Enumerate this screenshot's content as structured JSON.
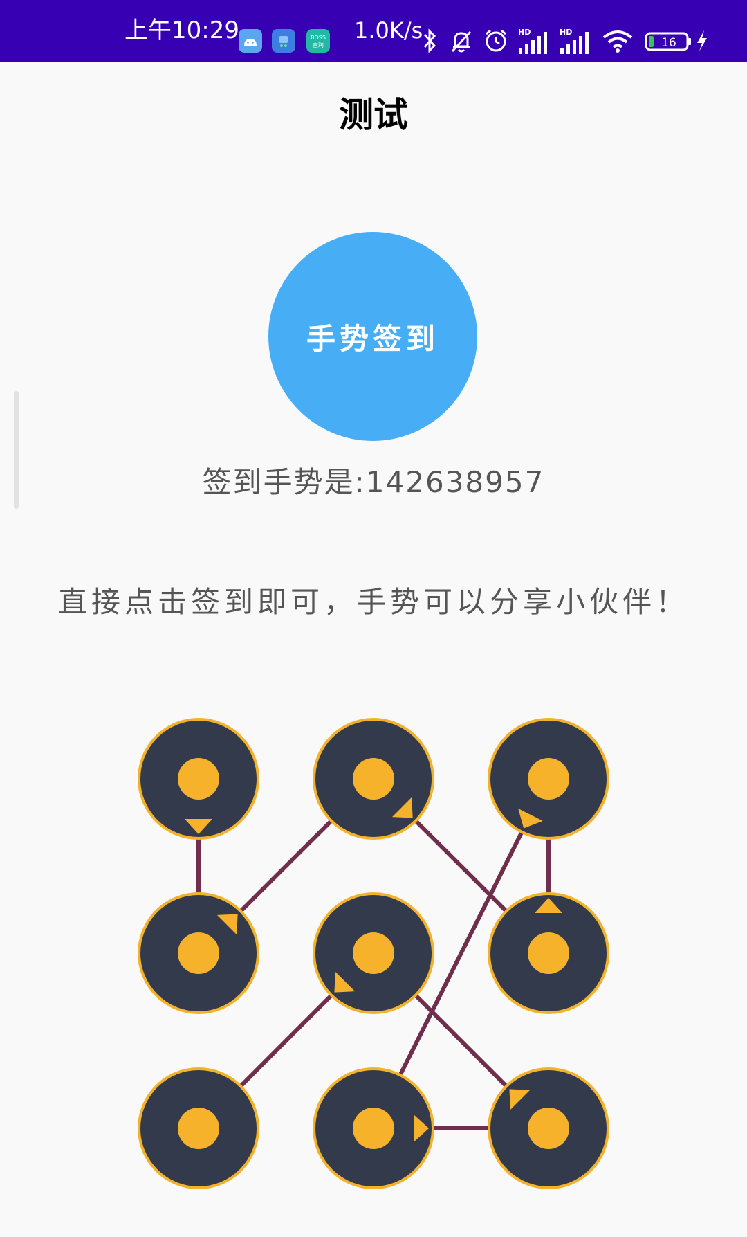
{
  "status_bar": {
    "time": "上午10:29",
    "network_speed": "1.0K/s",
    "battery": "16",
    "app_icons": [
      "android-icon",
      "app-icon",
      "boss-zhipin-icon"
    ],
    "boss_label": "BOSS 直聘",
    "hd_label": "HD",
    "icons": [
      "bluetooth-icon",
      "mute-bell-icon",
      "alarm-icon",
      "signal-hd-icon",
      "signal-hd-icon",
      "wifi-icon",
      "battery-icon",
      "charging-icon"
    ]
  },
  "page": {
    "title": "测试",
    "sign_button_label": "手势签到",
    "gesture_text": "签到手势是:142638957",
    "hint_text": "直接点击签到即可，手势可以分享小伙伴！"
  },
  "pattern": {
    "sequence": [
      1,
      4,
      2,
      6,
      3,
      8,
      9,
      5,
      7
    ],
    "colors": {
      "node_fill": "#333a4c",
      "node_ring": "#f3b229",
      "dot": "#f6b22b",
      "line": "#6e2e4c",
      "primary": "#3700b3",
      "button": "#47aef6"
    }
  }
}
